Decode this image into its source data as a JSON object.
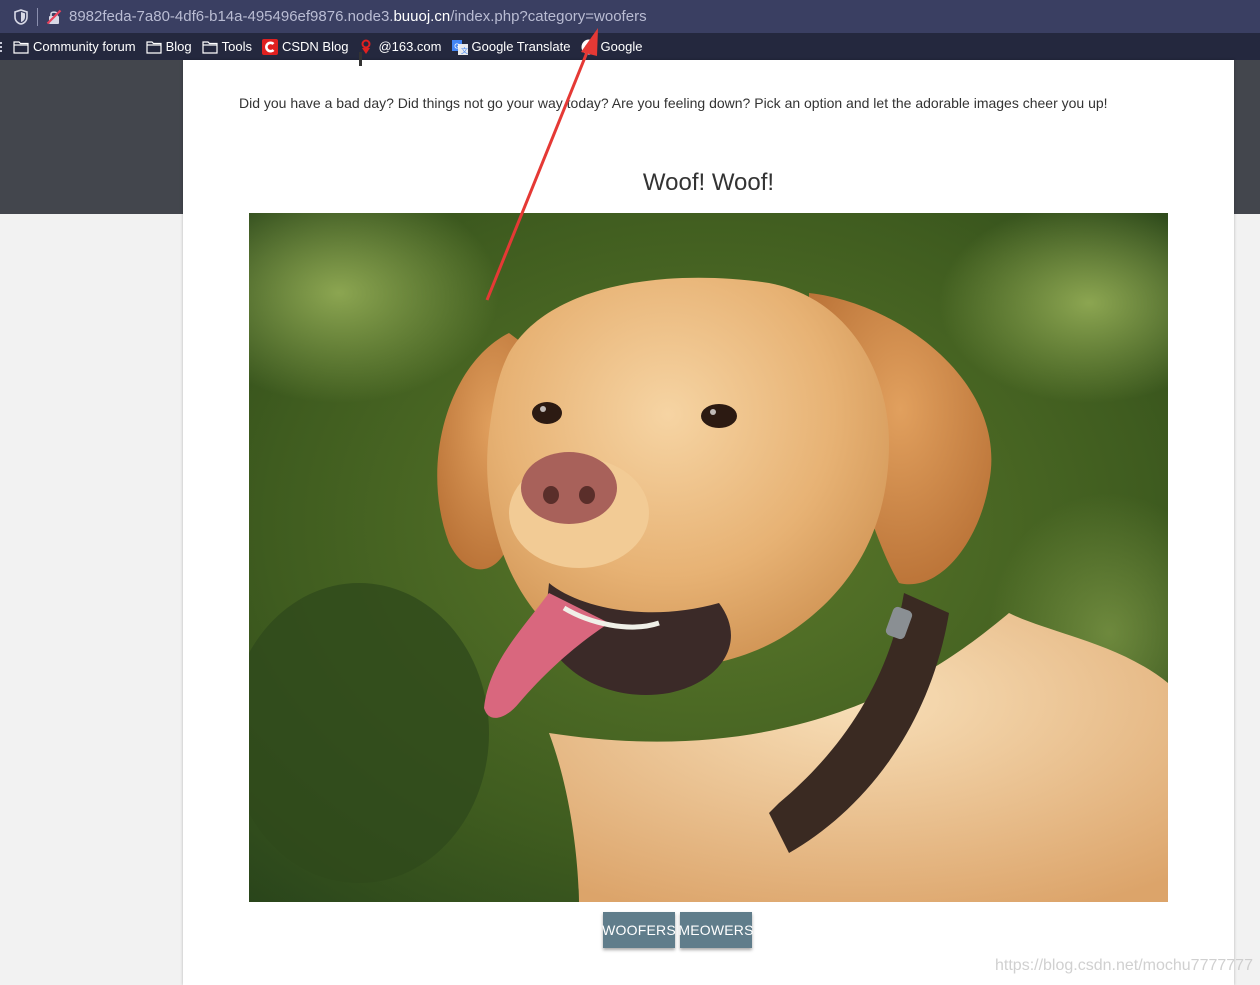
{
  "browser": {
    "url_prefix": "8982feda-7a80-4df6-b14a-495496ef9876.node3.",
    "url_host": "buuoj.cn",
    "url_path": "/index.php?category=woofers",
    "bookmarks": [
      {
        "label": "Community forum",
        "icon": "folder-icon"
      },
      {
        "label": "Blog",
        "icon": "folder-icon"
      },
      {
        "label": "Tools",
        "icon": "folder-icon"
      },
      {
        "label": "CSDN Blog",
        "icon": "csdn-icon"
      },
      {
        "label": "@163.com",
        "icon": "netease-mail-icon"
      },
      {
        "label": "Google Translate",
        "icon": "google-translate-icon"
      },
      {
        "label": "Google",
        "icon": "google-icon"
      }
    ]
  },
  "page": {
    "intro": "Did you have a bad day? Did things not go your way today? Are you feeling down? Pick an option and let the adorable images cheer you up!",
    "title": "Woof! Woof!",
    "image_subject": "golden-retriever-dog-photo",
    "buttons": {
      "woofers": "WOOFERS",
      "meowers": "MEOWERS"
    }
  },
  "overlay": {
    "watermark": "https://blog.csdn.net/mochu7777777",
    "annotation": "red-arrow-pointing-to-url"
  },
  "colors": {
    "urlbar": "#3a3f62",
    "bookmarks_bar": "#24283e",
    "button": "#607d8b",
    "arrow": "#e53935"
  }
}
